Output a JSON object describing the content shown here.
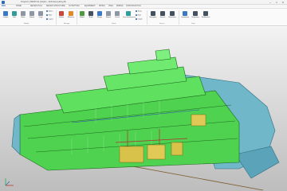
{
  "window": {
    "title": "ProjectX_PMWP-02 (shadm - 4163 Everything B)",
    "controls": {
      "minimize": "–",
      "maximize": "□",
      "close": "✕"
    }
  },
  "tabs": [
    "FILE",
    "HOME",
    "DESIGN HULL",
    "DESIGN STRUCTURE",
    "OUTFITTING",
    "EQUIPMENT",
    "PIPING",
    "HVAC",
    "WIRING",
    "CONSTRUCTION"
  ],
  "ribbon": {
    "buttons": [
      {
        "label": "Outline",
        "icon": "outline-icon",
        "color": "#3b78c4"
      },
      {
        "label": "Edit",
        "icon": "edit-icon",
        "color": "#2f9e9b"
      },
      {
        "label": "Move",
        "icon": "move-icon",
        "color": "#8c97a3"
      },
      {
        "label": "Rotate",
        "icon": "rotate-icon",
        "color": "#8c97a3"
      },
      {
        "label": "Copy",
        "icon": "copy-icon",
        "color": "#8c97a3"
      },
      {
        "label": "Delete",
        "icon": "delete-icon",
        "color": "#c64a3b"
      },
      {
        "label": "Measure",
        "icon": "measure-icon",
        "color": "#e08a2c"
      },
      {
        "label": "Model",
        "icon": "model-icon",
        "color": "#4e9a42"
      },
      {
        "label": "Build",
        "icon": "build-icon",
        "color": "#44515f"
      },
      {
        "label": "Merge",
        "icon": "merge-icon",
        "color": "#3b78c4"
      },
      {
        "label": "Sketch",
        "icon": "sketch-icon",
        "color": "#8c97a3"
      },
      {
        "label": "Check",
        "icon": "check-icon",
        "color": "#8c97a3"
      },
      {
        "label": "View Interference",
        "icon": "interference-icon",
        "color": "#2f9e9b"
      },
      {
        "label": "Navigator",
        "icon": "navigator-icon",
        "color": "#44515f"
      },
      {
        "label": "Search",
        "icon": "search-icon",
        "color": "#44515f"
      },
      {
        "label": "Selections",
        "icon": "selections-icon",
        "color": "#44515f"
      },
      {
        "label": "Comments",
        "icon": "comments-icon",
        "color": "#3b78c4"
      },
      {
        "label": "Properties",
        "icon": "properties-icon",
        "color": "#44515f"
      },
      {
        "label": "Workbench",
        "icon": "workbench-icon",
        "color": "#44515f"
      }
    ],
    "small_items": [
      "Select",
      "Filter",
      "Layers",
      "Show",
      "Hide",
      "Isolate"
    ],
    "groups": [
      "Modify",
      "Manage",
      "Check",
      "Search",
      "Tools"
    ]
  },
  "viewport": {
    "background": "#d6d6d6",
    "hull_color": "#6fb7c9",
    "structure_color": "#4fd24f",
    "machinery_color": "#d8c24a"
  }
}
